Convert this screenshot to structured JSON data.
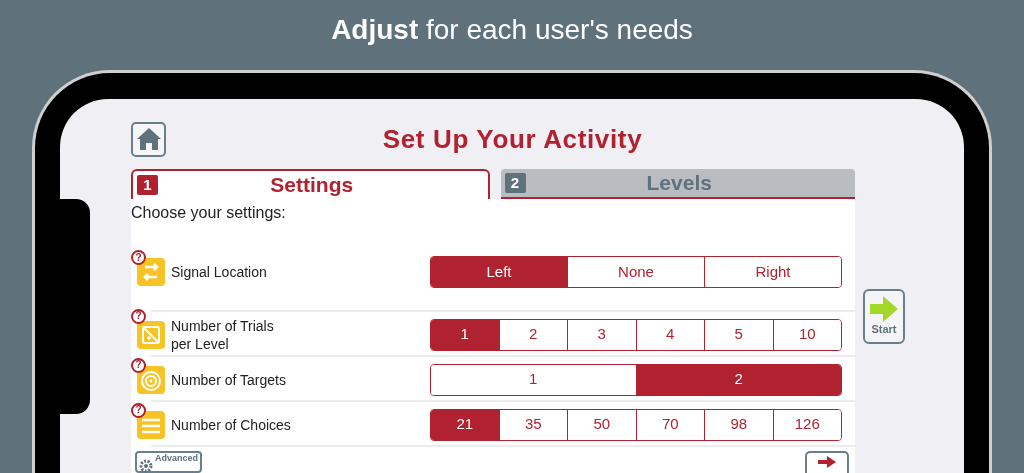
{
  "headline": "**Adjust** for each user's needs",
  "title": "Set Up Your Activity",
  "tabs": [
    {
      "number": "1",
      "label": "Settings",
      "selected": true
    },
    {
      "number": "2",
      "label": "Levels",
      "selected": false
    }
  ],
  "prompt": "Choose your settings:",
  "settings": [
    {
      "kind": "arrows",
      "help": "?",
      "label": "Signal Location",
      "options": [
        {
          "label": "Left",
          "selected": true
        },
        {
          "label": "None",
          "selected": false
        },
        {
          "label": "Right",
          "selected": false
        }
      ]
    },
    {
      "kind": "card",
      "help": "?",
      "label": "Number of Trials\nper Level",
      "options": [
        {
          "label": "1",
          "selected": true
        },
        {
          "label": "2",
          "selected": false
        },
        {
          "label": "3",
          "selected": false
        },
        {
          "label": "4",
          "selected": false
        },
        {
          "label": "5",
          "selected": false
        },
        {
          "label": "10",
          "selected": false
        }
      ]
    },
    {
      "kind": "target",
      "help": "?",
      "label": "Number of Targets",
      "options": [
        {
          "label": "1",
          "selected": false
        },
        {
          "label": "2",
          "selected": true
        }
      ]
    },
    {
      "kind": "lines",
      "help": "?",
      "label": "Number of Choices",
      "options": [
        {
          "label": "21",
          "selected": true
        },
        {
          "label": "35",
          "selected": false
        },
        {
          "label": "50",
          "selected": false
        },
        {
          "label": "70",
          "selected": false
        },
        {
          "label": "98",
          "selected": false
        },
        {
          "label": "126",
          "selected": false
        }
      ]
    }
  ],
  "advanced_button": "Advanced",
  "start_button": "Start"
}
